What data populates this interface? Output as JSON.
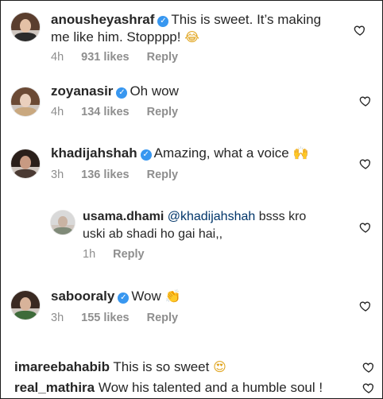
{
  "comments": [
    {
      "user": "anousheyashraf",
      "text": "This is sweet. It’s making",
      "text2": "me like him. Stopppp!",
      "emoji": "😂",
      "time": "4h",
      "likes": "931 likes",
      "reply": "Reply"
    },
    {
      "user": "zoyanasir",
      "text": "Oh wow",
      "time": "4h",
      "likes": "134 likes",
      "reply": "Reply"
    },
    {
      "user": "khadijahshah",
      "text": "Amazing, what a voice",
      "emoji": "🙌",
      "time": "3h",
      "likes": "136 likes",
      "reply": "Reply"
    },
    {
      "user": "usama.dhami",
      "mention": "@khadijahshah",
      "text": "bsss kro",
      "text2": "uski ab shadi ho gai hai,,",
      "time": "1h",
      "reply": "Reply"
    },
    {
      "user": "sabooraly",
      "text": "Wow",
      "emoji": "👏",
      "time": "3h",
      "likes": "155 likes",
      "reply": "Reply"
    },
    {
      "user": "imareebahabib",
      "text": "This is so sweet",
      "emoji": "😍"
    },
    {
      "user": "real_mathira",
      "text": "Wow his talented and a humble soul !"
    }
  ],
  "colors": {
    "verified": "#3897f0",
    "meta": "#8e8e8e",
    "mention": "#003569"
  },
  "icons": {
    "verified": "check-badge-icon",
    "like": "heart-outline-icon"
  }
}
